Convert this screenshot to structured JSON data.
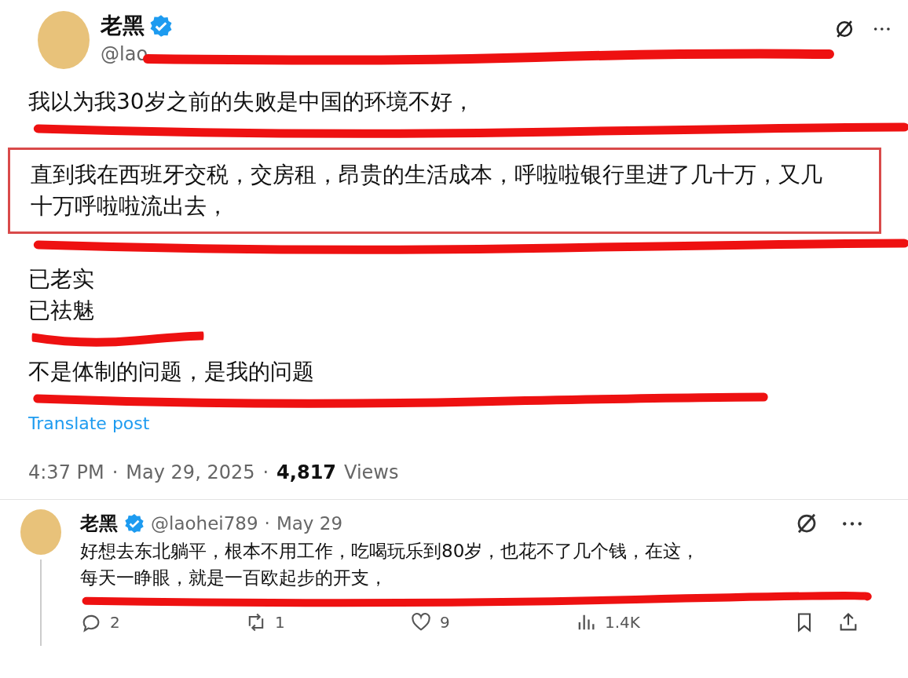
{
  "post": {
    "author": {
      "name": "老黑",
      "verified": true,
      "handle": "@lao"
    },
    "paragraphs": [
      {
        "lines": [
          "我以为我30岁之前的失败是中国的环境不好，"
        ],
        "highlighted": false
      },
      {
        "lines": [
          "直到我在西班牙交税，交房租，昂贵的生活成本，呼啦啦银行里进了几十万，又几十万呼啦啦流出去，"
        ],
        "highlighted": true
      },
      {
        "lines": [
          "已老实",
          "已祛魅"
        ],
        "highlighted": false
      },
      {
        "lines": [
          "不是体制的问题，是我的问题"
        ],
        "highlighted": false
      }
    ],
    "translate": "Translate post",
    "meta": {
      "time": "4:37 PM",
      "sep": "·",
      "date": "May 29, 2025",
      "views": "4,817",
      "views_label": "Views"
    }
  },
  "reply": {
    "author": {
      "name": "老黑",
      "verified": true,
      "handle": "@laohei789"
    },
    "sep": "·",
    "date": "May 29",
    "lines": [
      "好想去东北躺平，根本不用工作，吃喝玩乐到80岁，也花不了几个钱，在这，",
      "每天一睁眼，就是一百欧起步的开支，"
    ],
    "actions": {
      "replies": "2",
      "reposts": "1",
      "likes": "9",
      "views": "1.4K"
    }
  }
}
